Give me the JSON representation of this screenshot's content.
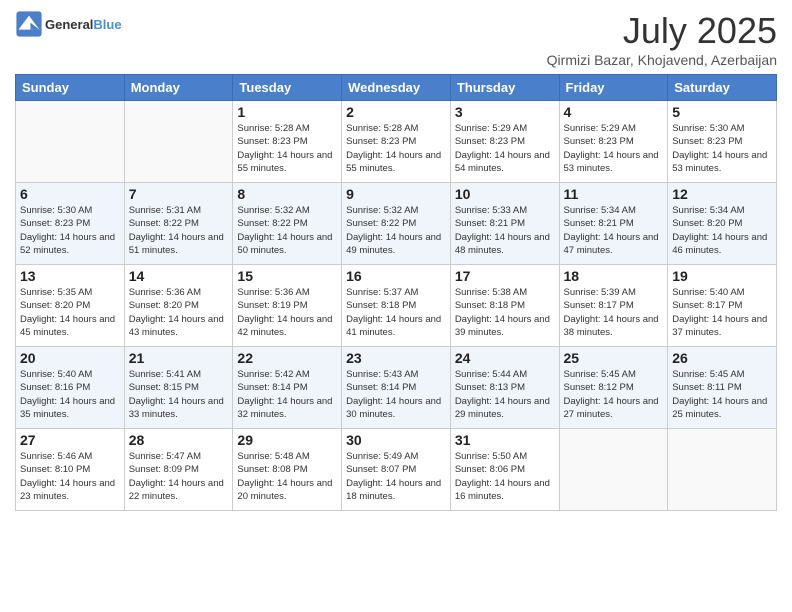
{
  "header": {
    "logo_general": "General",
    "logo_blue": "Blue",
    "month_title": "July 2025",
    "subtitle": "Qirmizi Bazar, Khojavend, Azerbaijan"
  },
  "days_of_week": [
    "Sunday",
    "Monday",
    "Tuesday",
    "Wednesday",
    "Thursday",
    "Friday",
    "Saturday"
  ],
  "weeks": [
    [
      {
        "num": "",
        "info": "",
        "empty": true
      },
      {
        "num": "",
        "info": "",
        "empty": true
      },
      {
        "num": "1",
        "info": "Sunrise: 5:28 AM\nSunset: 8:23 PM\nDaylight: 14 hours and 55 minutes."
      },
      {
        "num": "2",
        "info": "Sunrise: 5:28 AM\nSunset: 8:23 PM\nDaylight: 14 hours and 55 minutes."
      },
      {
        "num": "3",
        "info": "Sunrise: 5:29 AM\nSunset: 8:23 PM\nDaylight: 14 hours and 54 minutes."
      },
      {
        "num": "4",
        "info": "Sunrise: 5:29 AM\nSunset: 8:23 PM\nDaylight: 14 hours and 53 minutes."
      },
      {
        "num": "5",
        "info": "Sunrise: 5:30 AM\nSunset: 8:23 PM\nDaylight: 14 hours and 53 minutes."
      }
    ],
    [
      {
        "num": "6",
        "info": "Sunrise: 5:30 AM\nSunset: 8:23 PM\nDaylight: 14 hours and 52 minutes."
      },
      {
        "num": "7",
        "info": "Sunrise: 5:31 AM\nSunset: 8:22 PM\nDaylight: 14 hours and 51 minutes."
      },
      {
        "num": "8",
        "info": "Sunrise: 5:32 AM\nSunset: 8:22 PM\nDaylight: 14 hours and 50 minutes."
      },
      {
        "num": "9",
        "info": "Sunrise: 5:32 AM\nSunset: 8:22 PM\nDaylight: 14 hours and 49 minutes."
      },
      {
        "num": "10",
        "info": "Sunrise: 5:33 AM\nSunset: 8:21 PM\nDaylight: 14 hours and 48 minutes."
      },
      {
        "num": "11",
        "info": "Sunrise: 5:34 AM\nSunset: 8:21 PM\nDaylight: 14 hours and 47 minutes."
      },
      {
        "num": "12",
        "info": "Sunrise: 5:34 AM\nSunset: 8:20 PM\nDaylight: 14 hours and 46 minutes."
      }
    ],
    [
      {
        "num": "13",
        "info": "Sunrise: 5:35 AM\nSunset: 8:20 PM\nDaylight: 14 hours and 45 minutes."
      },
      {
        "num": "14",
        "info": "Sunrise: 5:36 AM\nSunset: 8:20 PM\nDaylight: 14 hours and 43 minutes."
      },
      {
        "num": "15",
        "info": "Sunrise: 5:36 AM\nSunset: 8:19 PM\nDaylight: 14 hours and 42 minutes."
      },
      {
        "num": "16",
        "info": "Sunrise: 5:37 AM\nSunset: 8:18 PM\nDaylight: 14 hours and 41 minutes."
      },
      {
        "num": "17",
        "info": "Sunrise: 5:38 AM\nSunset: 8:18 PM\nDaylight: 14 hours and 39 minutes."
      },
      {
        "num": "18",
        "info": "Sunrise: 5:39 AM\nSunset: 8:17 PM\nDaylight: 14 hours and 38 minutes."
      },
      {
        "num": "19",
        "info": "Sunrise: 5:40 AM\nSunset: 8:17 PM\nDaylight: 14 hours and 37 minutes."
      }
    ],
    [
      {
        "num": "20",
        "info": "Sunrise: 5:40 AM\nSunset: 8:16 PM\nDaylight: 14 hours and 35 minutes."
      },
      {
        "num": "21",
        "info": "Sunrise: 5:41 AM\nSunset: 8:15 PM\nDaylight: 14 hours and 33 minutes."
      },
      {
        "num": "22",
        "info": "Sunrise: 5:42 AM\nSunset: 8:14 PM\nDaylight: 14 hours and 32 minutes."
      },
      {
        "num": "23",
        "info": "Sunrise: 5:43 AM\nSunset: 8:14 PM\nDaylight: 14 hours and 30 minutes."
      },
      {
        "num": "24",
        "info": "Sunrise: 5:44 AM\nSunset: 8:13 PM\nDaylight: 14 hours and 29 minutes."
      },
      {
        "num": "25",
        "info": "Sunrise: 5:45 AM\nSunset: 8:12 PM\nDaylight: 14 hours and 27 minutes."
      },
      {
        "num": "26",
        "info": "Sunrise: 5:45 AM\nSunset: 8:11 PM\nDaylight: 14 hours and 25 minutes."
      }
    ],
    [
      {
        "num": "27",
        "info": "Sunrise: 5:46 AM\nSunset: 8:10 PM\nDaylight: 14 hours and 23 minutes."
      },
      {
        "num": "28",
        "info": "Sunrise: 5:47 AM\nSunset: 8:09 PM\nDaylight: 14 hours and 22 minutes."
      },
      {
        "num": "29",
        "info": "Sunrise: 5:48 AM\nSunset: 8:08 PM\nDaylight: 14 hours and 20 minutes."
      },
      {
        "num": "30",
        "info": "Sunrise: 5:49 AM\nSunset: 8:07 PM\nDaylight: 14 hours and 18 minutes."
      },
      {
        "num": "31",
        "info": "Sunrise: 5:50 AM\nSunset: 8:06 PM\nDaylight: 14 hours and 16 minutes."
      },
      {
        "num": "",
        "info": "",
        "empty": true
      },
      {
        "num": "",
        "info": "",
        "empty": true
      }
    ]
  ]
}
